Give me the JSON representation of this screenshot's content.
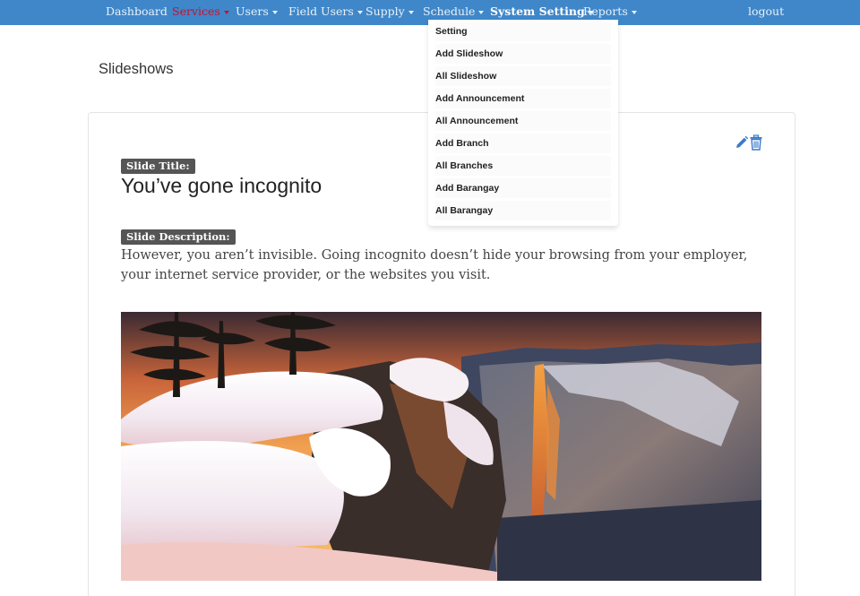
{
  "nav": {
    "items": [
      {
        "label": "Dashboard"
      },
      {
        "label": "Services",
        "active": true
      },
      {
        "label": "Users"
      },
      {
        "label": "Field Users"
      },
      {
        "label": "Supply"
      },
      {
        "label": "Schedule"
      },
      {
        "label": "System Setting",
        "open": true
      },
      {
        "label": "Reports"
      }
    ],
    "logout_label": "logout"
  },
  "page": {
    "title": "Slideshows"
  },
  "slide": {
    "title_label": "Slide Title:",
    "title": "You’ve gone incognito",
    "description_label": "Slide Description:",
    "description": "However, you aren’t invisible. Going incognito doesn’t hide your browsing from your employer, your internet service provider, or the websites you visit.",
    "edit_icon": "pencil-icon",
    "delete_icon": "trash-icon"
  },
  "dropdown": {
    "items": [
      "Setting",
      "Add Slideshow",
      "All Slideshow",
      "Add Announcement",
      "All Announcement",
      "Add Branch",
      "All Branches",
      "Add Barangay",
      "All Barangay"
    ]
  },
  "colors": {
    "navbar": "#3f87c9",
    "active_nav": "#c8102e",
    "badge": "#555555",
    "icon": "#3a7bc8"
  }
}
